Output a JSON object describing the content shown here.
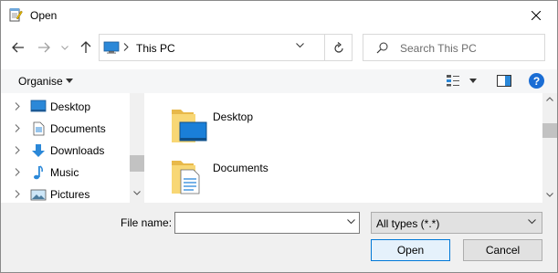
{
  "window": {
    "title": "Open"
  },
  "nav": {
    "back_icon": "arrow-left-icon",
    "forward_icon": "arrow-right-icon",
    "recent_icon": "chevron-down-icon",
    "up_icon": "arrow-up-icon"
  },
  "address": {
    "location": "This PC"
  },
  "search": {
    "placeholder": "Search This PC"
  },
  "commands": {
    "organise_label": "Organise"
  },
  "navpane": {
    "items": [
      {
        "label": "Desktop",
        "icon": "desktop-icon"
      },
      {
        "label": "Documents",
        "icon": "documents-icon"
      },
      {
        "label": "Downloads",
        "icon": "downloads-icon"
      },
      {
        "label": "Music",
        "icon": "music-icon"
      },
      {
        "label": "Pictures",
        "icon": "pictures-icon"
      }
    ]
  },
  "content": {
    "items": [
      {
        "label": "Desktop",
        "icon": "desktop-folder-icon"
      },
      {
        "label": "Documents",
        "icon": "documents-folder-icon"
      }
    ]
  },
  "footer": {
    "file_name_label": "File name:",
    "file_name_value": "",
    "file_type_selected": "All types (*.*)",
    "open_label": "Open",
    "cancel_label": "Cancel"
  },
  "colors": {
    "accent": "#0078d7",
    "help": "#1a6dd4",
    "folder": "#f8d775",
    "panel": "#f0f0f0"
  }
}
